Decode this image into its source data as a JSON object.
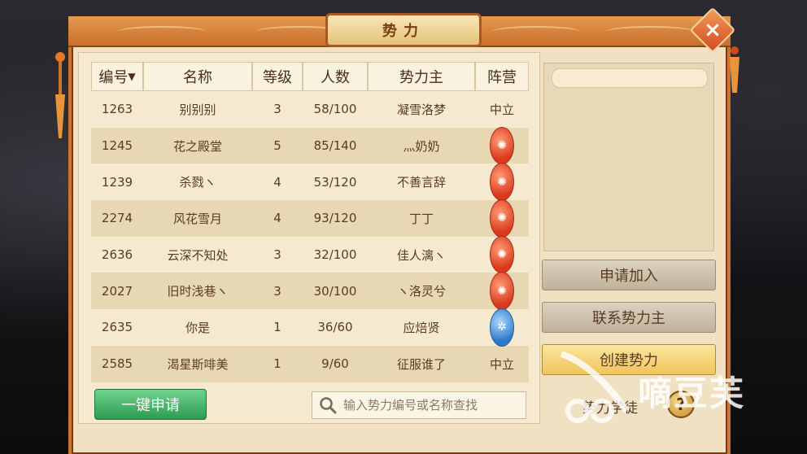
{
  "window": {
    "title": "势力",
    "close_label": "×"
  },
  "table": {
    "columns": [
      "编号",
      "名称",
      "等级",
      "人数",
      "势力主",
      "阵营"
    ],
    "sort_indicator": "▼",
    "rows": [
      {
        "id": "1263",
        "name": "别别别",
        "level": "3",
        "members": "58/100",
        "leader": "凝雪洛梦",
        "camp": "中立",
        "camp_icon": "none"
      },
      {
        "id": "1245",
        "name": "花之殿堂",
        "level": "5",
        "members": "85/140",
        "leader": "灬奶奶",
        "camp": "",
        "camp_icon": "fire-emblem-icon"
      },
      {
        "id": "1239",
        "name": "杀戮ヽ",
        "level": "4",
        "members": "53/120",
        "leader": "不善言辞",
        "camp": "",
        "camp_icon": "fire-emblem-icon"
      },
      {
        "id": "2274",
        "name": "风花雪月",
        "level": "4",
        "members": "93/120",
        "leader": "丁丁",
        "camp": "",
        "camp_icon": "fire-emblem-icon"
      },
      {
        "id": "2636",
        "name": "云深不知处",
        "level": "3",
        "members": "32/100",
        "leader": "佳人漓ヽ",
        "camp": "",
        "camp_icon": "fire-emblem-icon"
      },
      {
        "id": "2027",
        "name": "旧时浅巷ヽ",
        "level": "3",
        "members": "30/100",
        "leader": "ヽ洛灵兮",
        "camp": "",
        "camp_icon": "fire-emblem-icon"
      },
      {
        "id": "2635",
        "name": "你是",
        "level": "1",
        "members": "36/60",
        "leader": "应焙贤",
        "camp": "",
        "camp_icon": "ice-emblem-icon"
      },
      {
        "id": "2585",
        "name": "渴星斯啡美",
        "level": "1",
        "members": "9/60",
        "leader": "征服谁了",
        "camp": "中立",
        "camp_icon": "none"
      }
    ]
  },
  "bottom": {
    "apply_all_label": "一键申请",
    "search_placeholder": "输入势力编号或名称查找"
  },
  "side": {
    "apply_join_label": "申请加入",
    "contact_leader_label": "联系势力主",
    "create_label": "创建势力",
    "faq_label": "势力学徒",
    "help_label": "?"
  },
  "watermark": {
    "text": "嘀豆芙"
  },
  "colors": {
    "accent": "#c9762f",
    "fire": "#d9391c",
    "ice": "#2e78c9",
    "green_button": "#2e9b52",
    "gold_button": "#efc55b"
  }
}
